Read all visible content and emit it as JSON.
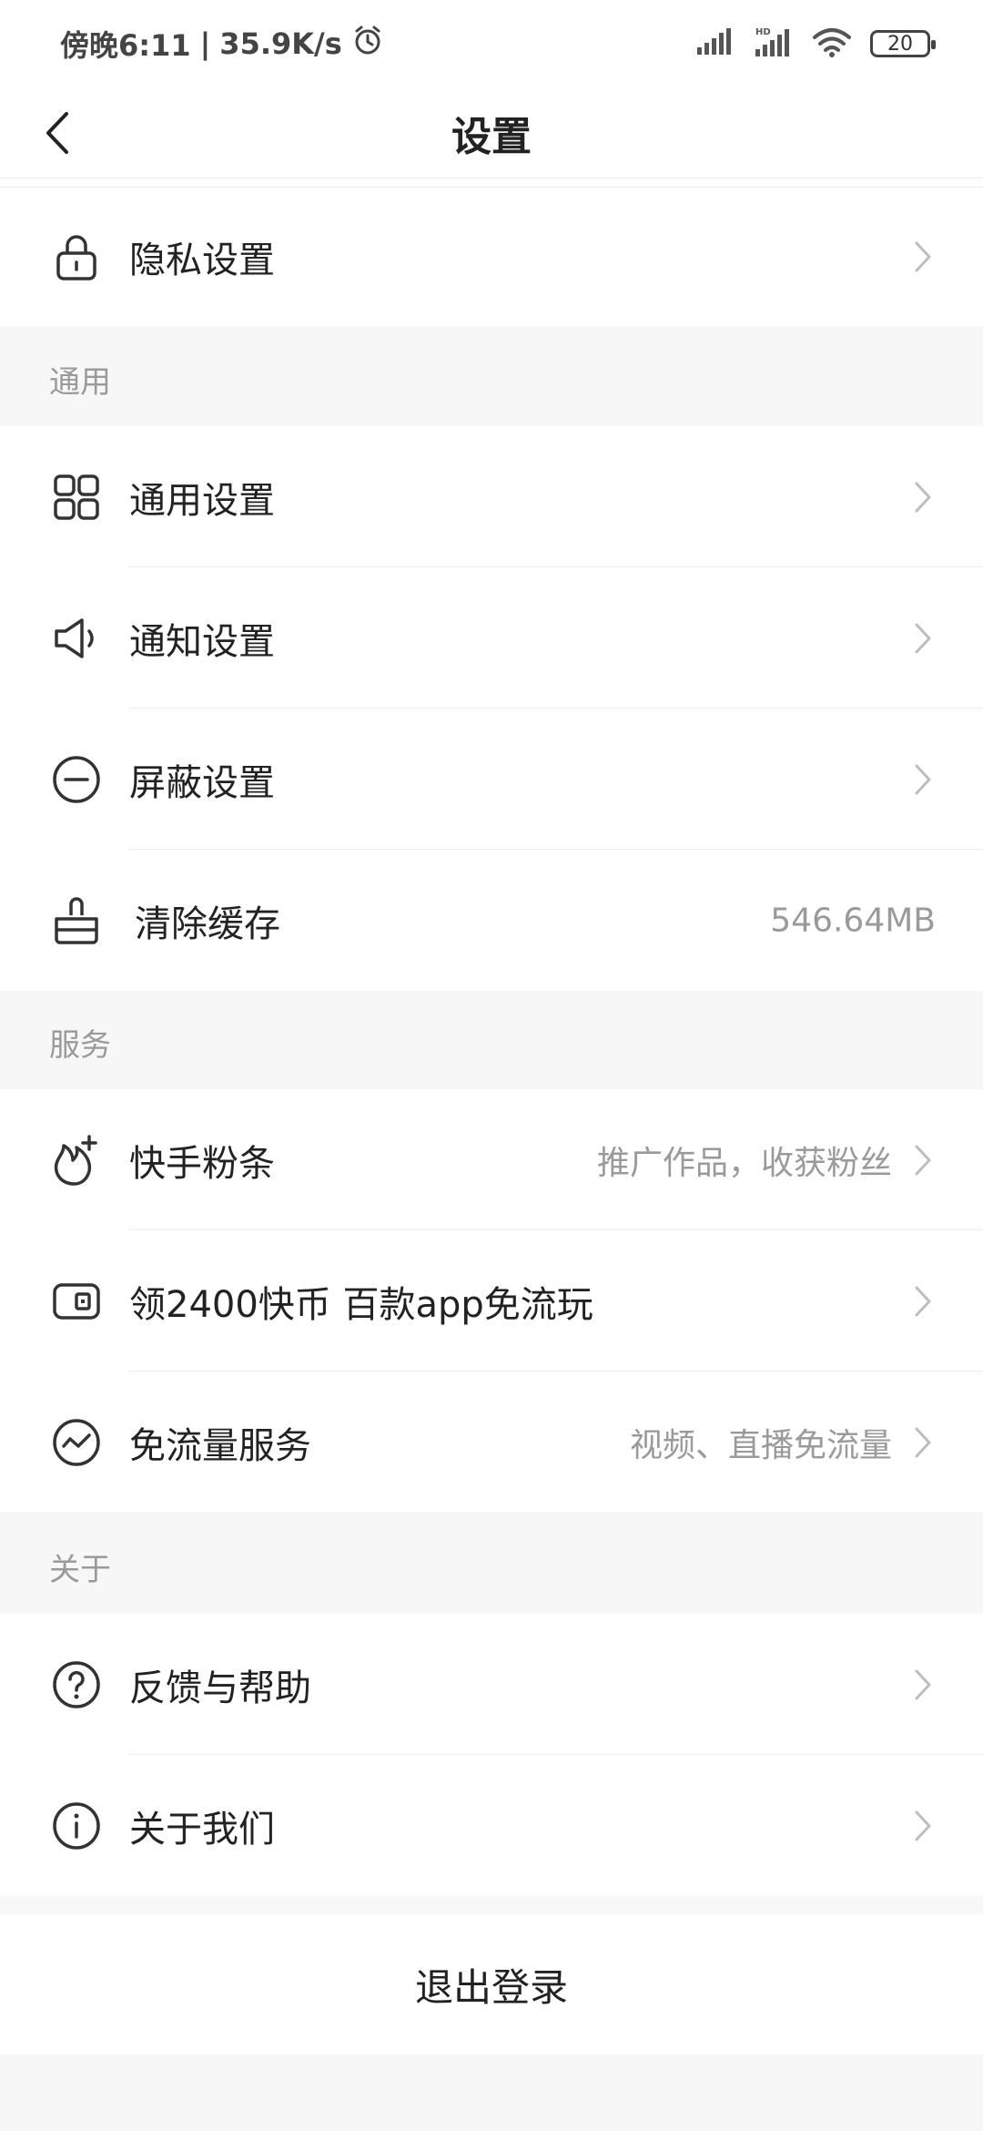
{
  "status_bar": {
    "time": "傍晚6:11",
    "speed": "35.9K/s",
    "battery": "20"
  },
  "header": {
    "title": "设置"
  },
  "rows": {
    "privacy": {
      "label": "隐私设置",
      "icon": "lock-icon"
    },
    "general": {
      "label": "通用设置",
      "icon": "grid-icon"
    },
    "notify": {
      "label": "通知设置",
      "icon": "speaker-icon"
    },
    "block": {
      "label": "屏蔽设置",
      "icon": "minus-circle-icon"
    },
    "cache": {
      "label": "清除缓存",
      "value": "546.64MB",
      "icon": "broom-icon"
    },
    "fans": {
      "label": "快手粉条",
      "value": "推广作品，收获粉丝",
      "icon": "flame-plus-icon"
    },
    "coins": {
      "label": "领2400快币 百款app免流玩",
      "icon": "coin-card-icon"
    },
    "dataflow": {
      "label": "免流量服务",
      "value": "视频、直播免流量",
      "icon": "wave-circle-icon"
    },
    "feedback": {
      "label": "反馈与帮助",
      "icon": "question-circle-icon"
    },
    "about": {
      "label": "关于我们",
      "icon": "info-circle-icon"
    }
  },
  "sections": {
    "general": "通用",
    "services": "服务",
    "about": "关于"
  },
  "logout_label": "退出登录"
}
